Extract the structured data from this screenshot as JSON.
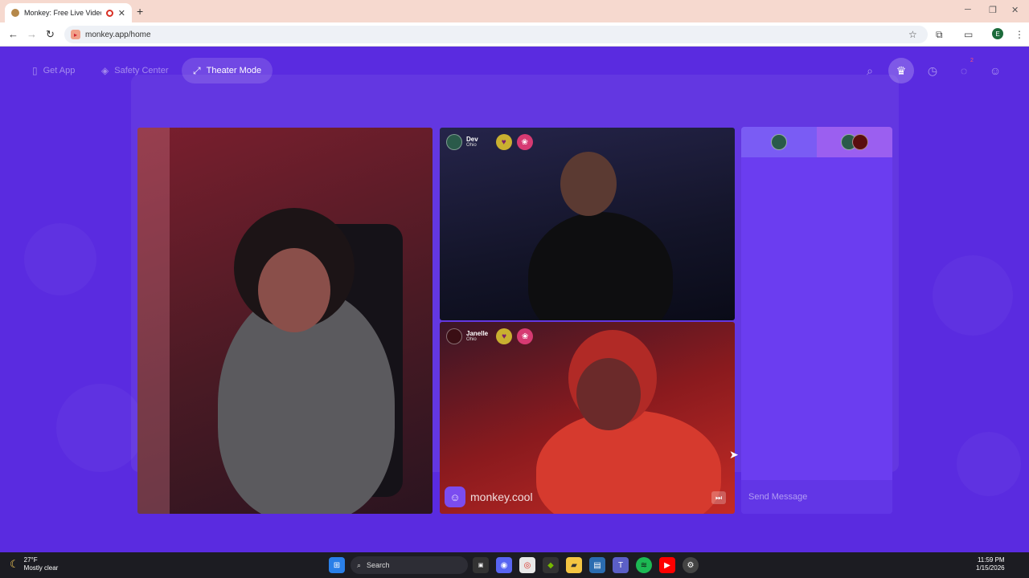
{
  "browser": {
    "tab_title": "Monkey: Free Live Video Ch",
    "tab_close": "✕",
    "new_tab": "+",
    "url": "monkey.app/home",
    "profile_initial": "E"
  },
  "nav": {
    "get_app": "Get App",
    "safety_center": "Safety Center",
    "theater_mode": "Theater Mode",
    "notification_count": "2"
  },
  "peers": {
    "dev": {
      "name": "Dev",
      "location": "Ohio"
    },
    "janelle": {
      "name": "Janelle",
      "location": "Ohio"
    }
  },
  "watermark": "monkey.cool",
  "chat": {
    "placeholder": "Send Message"
  },
  "taskbar": {
    "temperature": "27°F",
    "weather": "Mostly clear",
    "search": "Search",
    "time": "11:59 PM",
    "date": "1/15/2026"
  },
  "colors": {
    "app_bg": "#5a2be0",
    "chat_panel": "#6b3df0",
    "tab_strip": "#f6d9cf"
  }
}
